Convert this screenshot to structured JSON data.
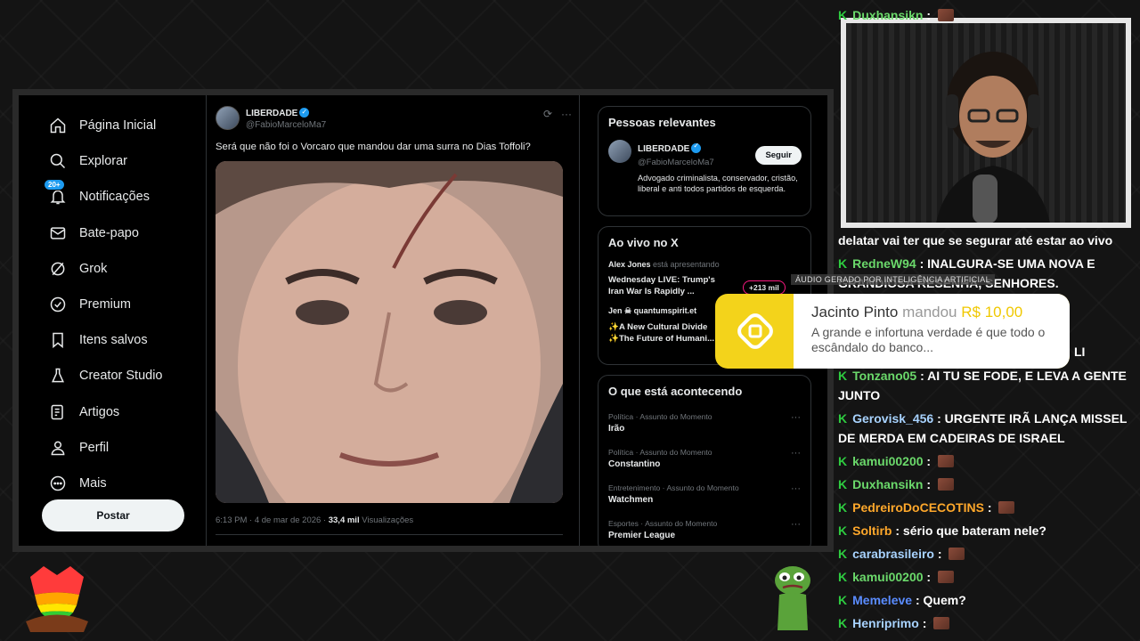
{
  "nav": {
    "items": [
      {
        "label": "Página Inicial",
        "icon": "home-icon"
      },
      {
        "label": "Explorar",
        "icon": "search-icon"
      },
      {
        "label": "Notificações",
        "icon": "bell-icon",
        "badge": "20+"
      },
      {
        "label": "Bate-papo",
        "icon": "mail-icon"
      },
      {
        "label": "Grok",
        "icon": "grok-icon"
      },
      {
        "label": "Premium",
        "icon": "premium-icon"
      },
      {
        "label": "Itens salvos",
        "icon": "bookmark-icon"
      },
      {
        "label": "Creator Studio",
        "icon": "flask-icon"
      },
      {
        "label": "Artigos",
        "icon": "article-icon"
      },
      {
        "label": "Perfil",
        "icon": "person-icon"
      },
      {
        "label": "Mais",
        "icon": "more-icon"
      }
    ],
    "post_label": "Postar"
  },
  "tweet": {
    "name": "LIBERDADE",
    "handle": "@FabioMarceloMa7",
    "text": "Será que não foi o Vorcaro que mandou dar uma surra no Dias Toffoli?",
    "time": "6:13 PM · 4 de mar de 2026 · ",
    "views_count": "33,4 mil",
    "views_label": " Visualizações"
  },
  "relevant": {
    "title": "Pessoas relevantes",
    "name": "LIBERDADE",
    "handle": "@FabioMarceloMa7",
    "follow_label": "Seguir",
    "bio": "Advogado criminalista, conservador, cristão, liberal e anti todos partidos de esquerda."
  },
  "live": {
    "title": "Ao vivo no X",
    "items": [
      {
        "host": "Alex Jones",
        "host_suffix": " está apresentando",
        "title": "Wednesday LIVE: Trump's Iran War Is Rapidly ..."
      },
      {
        "host": "Jen ☠ quantumspirit.et",
        "host_suffix": "",
        "title": "✨A New Cultural Divide ✨The Future of Humani..."
      }
    ],
    "listeners": "+213 mil"
  },
  "trends": {
    "title": "O que está acontecendo",
    "items": [
      {
        "category": "Política · Assunto do Momento",
        "name": "Irão"
      },
      {
        "category": "Política · Assunto do Momento",
        "name": "Constantino"
      },
      {
        "category": "Entretenimento · Assunto do Momento",
        "name": "Watchmen"
      },
      {
        "category": "Esportes · Assunto do Momento",
        "name": "Premier League"
      }
    ]
  },
  "alert": {
    "tag": "ÁUDIO GERADO POR INTELIGÊNCIA ARTIFICIAL",
    "donor": "Jacinto Pinto",
    "word": "mandou",
    "amount": "R$ 10,00",
    "message": "A grande e infortuna verdade é que todo o escândalo do banco...",
    "color": "#f3d31b"
  },
  "chat": [
    {
      "user": "Duxhansikn",
      "text": "",
      "emote": true,
      "color": "c-green"
    },
    {
      "user": "",
      "text": "delatar vai ter que se segurar até estar ao vivo",
      "emote": false,
      "color": "c-white"
    },
    {
      "user": "RedneW94",
      "text": "INALGURA-SE UMA NOVA E GRANDIOSA RESENHA, SENHORES.",
      "emote": false,
      "color": "c-green"
    },
    {
      "user": "",
      "text": "LI",
      "emote": false,
      "color": "c-white"
    },
    {
      "user": "Tonzano05",
      "text": "AI TU SE FODE, E LEVA A GENTE JUNTO",
      "emote": false,
      "color": "c-green"
    },
    {
      "user": "Gerovisk_456",
      "text": "URGENTE IRÃ LANÇA MISSEL DE MERDA EM CADEIRAS DE ISRAEL",
      "emote": false,
      "color": "c-lblue"
    },
    {
      "user": "kamui00200",
      "text": "",
      "emote": true,
      "color": "c-green"
    },
    {
      "user": "Duxhansikn",
      "text": "",
      "emote": true,
      "color": "c-green"
    },
    {
      "user": "PedreiroDoCECOTINS",
      "text": "",
      "emote": true,
      "color": "c-orange"
    },
    {
      "user": "Soltirb",
      "text": "sério que bateram nele?",
      "emote": false,
      "color": "c-orange"
    },
    {
      "user": "carabrasileiro",
      "text": "",
      "emote": true,
      "color": "c-lblue"
    },
    {
      "user": "kamui00200",
      "text": "",
      "emote": true,
      "color": "c-green"
    },
    {
      "user": "Memeleve",
      "text": "Quem?",
      "emote": false,
      "color": "c-blue"
    },
    {
      "user": "Henriprimo",
      "text": "",
      "emote": true,
      "color": "c-lblue"
    }
  ]
}
